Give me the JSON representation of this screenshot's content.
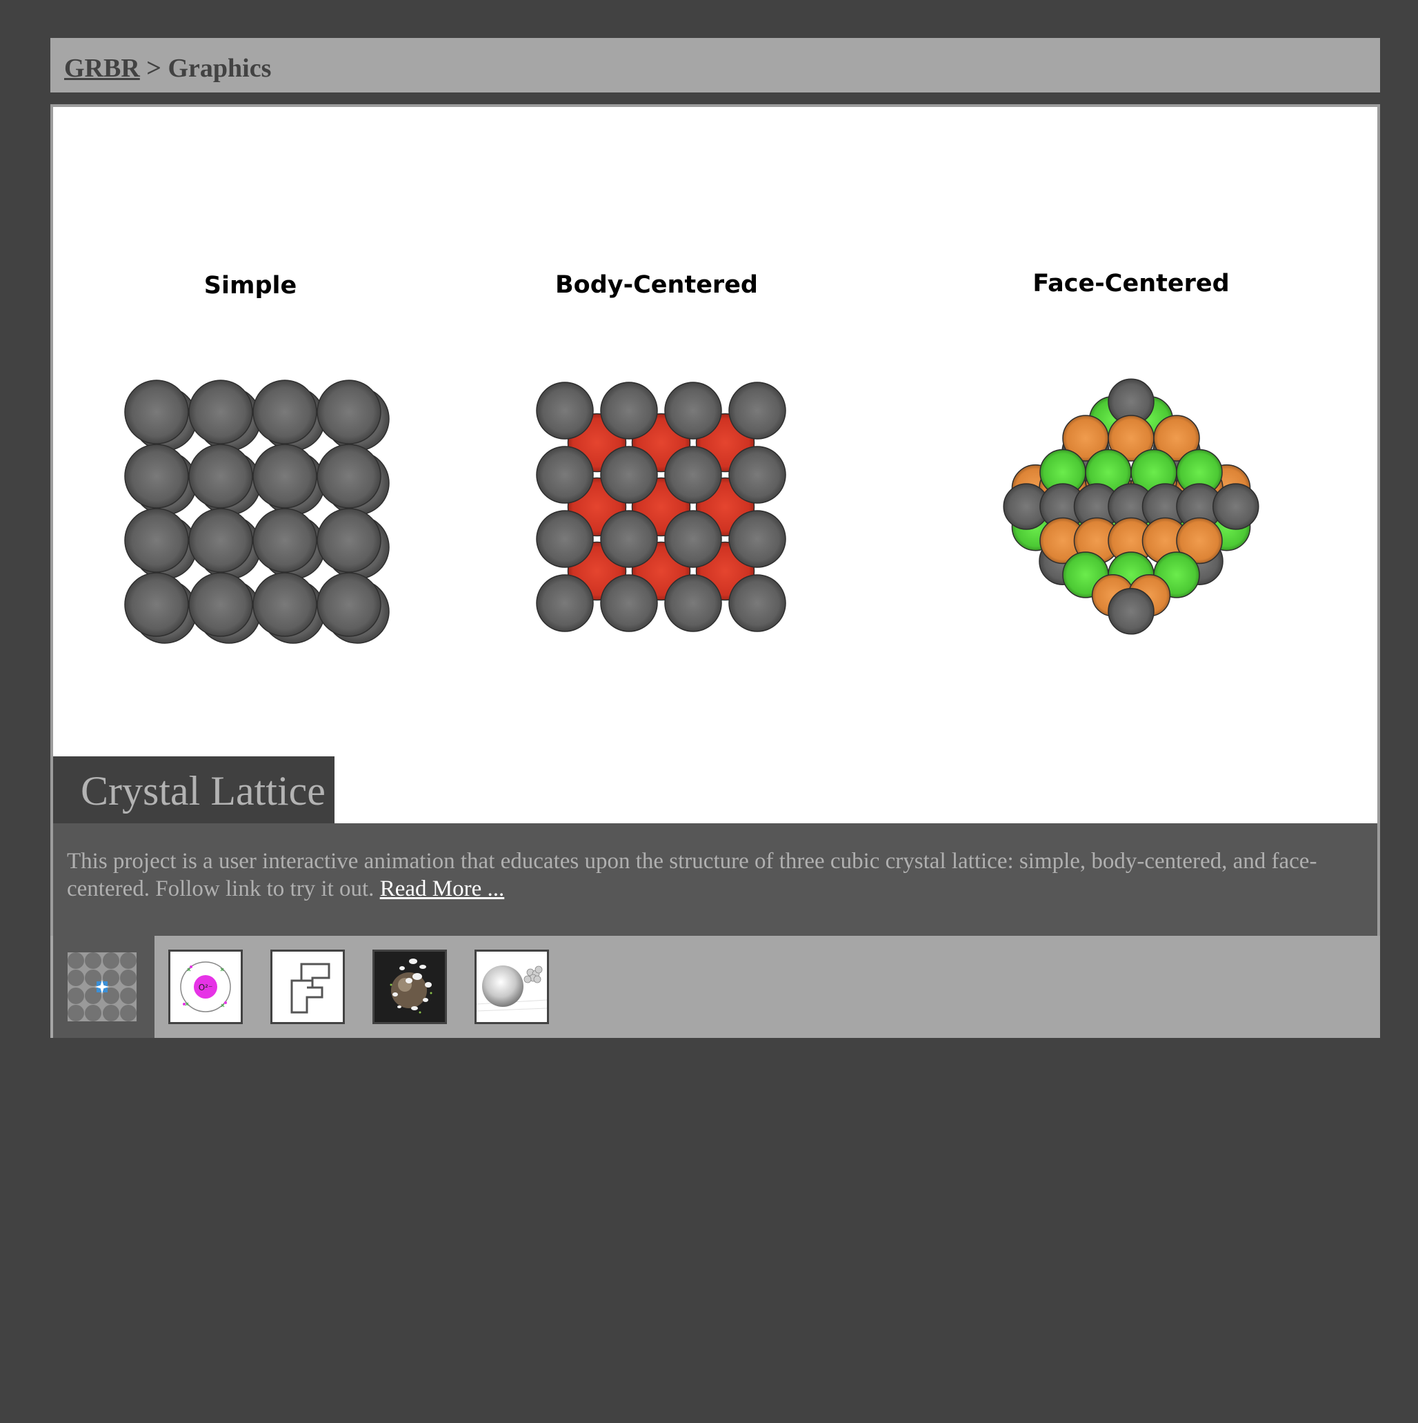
{
  "breadcrumb": {
    "root_link": "GRBR",
    "separator": ">",
    "current": "Graphics"
  },
  "viewer": {
    "labels": {
      "simple": "Simple",
      "body_centered": "Body-Centered",
      "face_centered": "Face-Centered"
    },
    "colors": {
      "corner_atom": "#6b6b6b",
      "body_atom": "#d83a2a",
      "face_green": "#55d63a",
      "face_orange": "#e68d3c"
    }
  },
  "project": {
    "title": "Crystal Lattice",
    "description": "This project is a user interactive animation that educates upon the structure of three cubic crystal lattice: simple, body-centered, and face-centered. Follow link to try it out.",
    "read_more": "Read More ..."
  },
  "thumbnails": [
    {
      "name": "crystal-lattice-thumbnail",
      "active": true
    },
    {
      "name": "atom-orbital-thumbnail",
      "inner_text": "O²⁻",
      "active": false
    },
    {
      "name": "maze-thumbnail",
      "active": false
    },
    {
      "name": "particle-sphere-thumbnail",
      "active": false
    },
    {
      "name": "sphere-collision-thumbnail",
      "active": false
    }
  ]
}
